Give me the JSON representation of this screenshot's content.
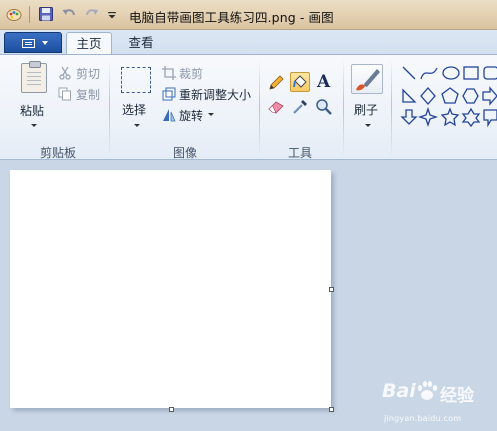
{
  "window": {
    "title": "电脑自带画图工具练习四.png - 画图"
  },
  "tabs": {
    "home": "主页",
    "view": "查看"
  },
  "ribbon": {
    "clipboard": {
      "label": "剪贴板",
      "paste": "粘贴",
      "cut": "剪切",
      "copy": "复制"
    },
    "image": {
      "label": "图像",
      "select": "选择",
      "crop": "裁剪",
      "resize": "重新调整大小",
      "rotate": "旋转"
    },
    "tools": {
      "label": "工具",
      "text_glyph": "A"
    },
    "brushes": {
      "label": "刷子"
    }
  },
  "watermark": {
    "brand": "Bai",
    "brand_suffix": "经验",
    "url": "jingyan.baidu.com"
  },
  "colors": {
    "titlebar": "#e6d3b5",
    "ribbon": "#eef3f9",
    "workspace": "#c9d6e6",
    "file_button": "#2a5db0",
    "pressed_tool": "#f7c962"
  }
}
